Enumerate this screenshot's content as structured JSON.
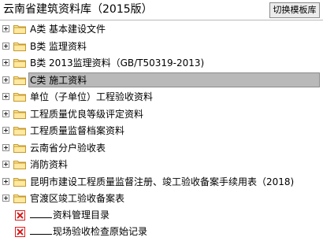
{
  "header": {
    "title": "云南省建筑资料库（2015版）",
    "switch_button": "切换模板库"
  },
  "tree": {
    "folders": [
      "A类 基本建设文件",
      "B类 监理资料",
      "B类 2013监理资料（GB/T50319-2013)",
      "C类 施工资料",
      "单位（子单位）工程验收资料",
      "工程质量优良等级评定资料",
      "工程质量监督档案资料",
      "云南省分户验收表",
      "消防资料",
      "昆明市建设工程质量监督注册、竣工验收备案手续用表（2018)",
      "官渡区竣工验收备案表"
    ],
    "selected_index": 3,
    "documents": [
      "资料管理目录",
      "现场验收检查原始记录"
    ]
  }
}
